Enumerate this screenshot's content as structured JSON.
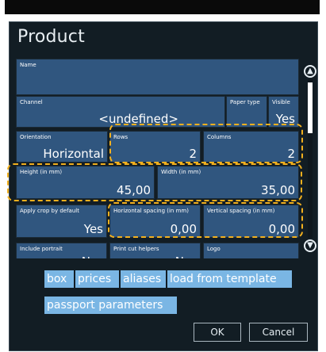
{
  "dialog": {
    "title": "Product"
  },
  "fields": {
    "name": {
      "label": "Name",
      "value": ""
    },
    "channel": {
      "label": "Channel",
      "value": "<undefined>"
    },
    "paper_type": {
      "label": "Paper type",
      "value": ""
    },
    "visible": {
      "label": "Visible",
      "value": "Yes"
    },
    "orientation": {
      "label": "Orientation",
      "value": "Horizontal"
    },
    "rows": {
      "label": "Rows",
      "value": "2"
    },
    "columns": {
      "label": "Columns",
      "value": "2"
    },
    "height": {
      "label": "Height (in mm)",
      "value": "45,00"
    },
    "width": {
      "label": "Width (in mm)",
      "value": "35,00"
    },
    "apply_crop": {
      "label": "Apply crop by default",
      "value": "Yes"
    },
    "h_spacing": {
      "label": "Horizontal spacing (in mm)",
      "value": "0,00"
    },
    "v_spacing": {
      "label": "Vertical spacing (in mm)",
      "value": "0,00"
    },
    "include_portrait": {
      "label": "Include portrait",
      "value": "N"
    },
    "print_cut_helpers": {
      "label": "Print cut helpers",
      "value": "N"
    },
    "logo": {
      "label": "Logo",
      "value": ""
    }
  },
  "tabs": [
    "box",
    "prices",
    "aliases",
    "load from template",
    "passport parameters"
  ],
  "buttons": {
    "ok": "OK",
    "cancel": "Cancel"
  },
  "icons": {
    "scroll_up": "up-arrow-circle-icon",
    "scroll_down": "down-arrow-circle-icon"
  },
  "colors": {
    "field": "#30567f",
    "dialog_bg": "#121d24",
    "tab": "#7ab6e4",
    "highlight": "#f2b01e"
  }
}
